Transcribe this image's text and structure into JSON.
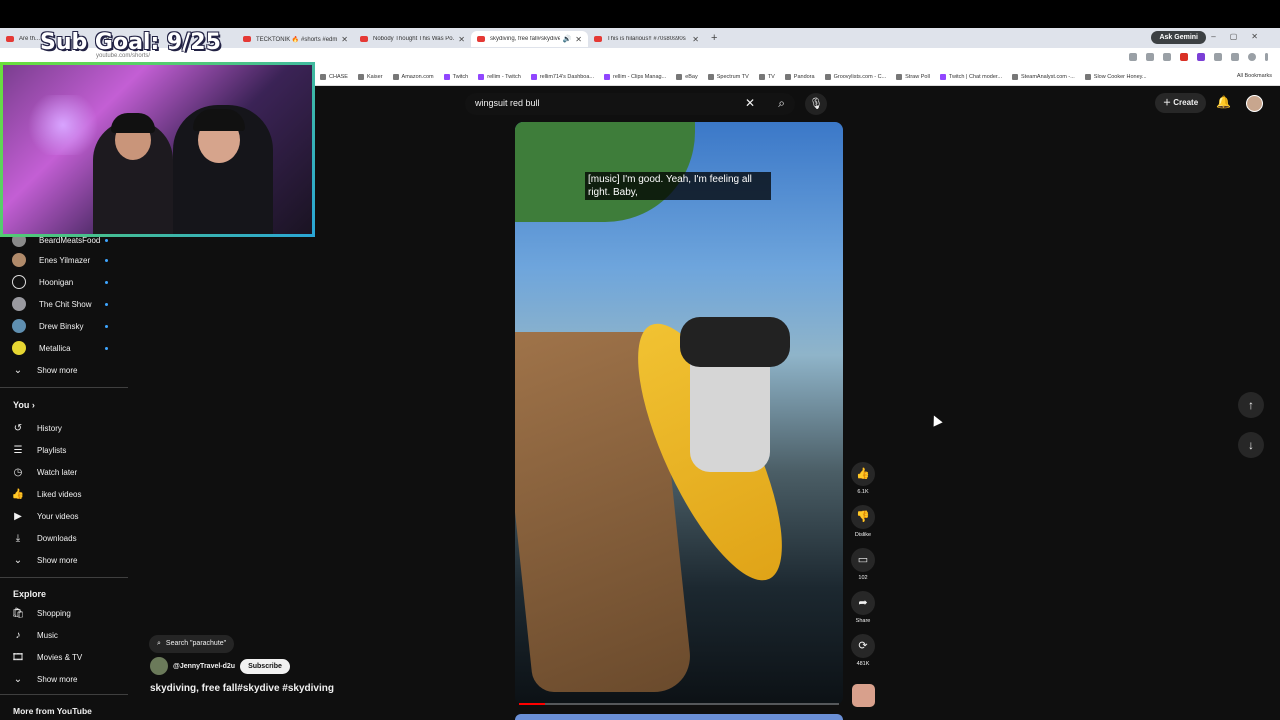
{
  "overlay": {
    "sub_goal": "Sub Goal: 9/25"
  },
  "browser": {
    "tabs": [
      {
        "title": "Are th..."
      },
      {
        "title": "TECKTONIK 🔥 #shorts #edm"
      },
      {
        "title": "Nobody Thought This Was Po..."
      },
      {
        "title": "skydiving, free fall#skydive",
        "active": true
      },
      {
        "title": "This is hilarious!! #70s80s90s"
      }
    ],
    "ask_gemini": "Ask Gemini",
    "url": "youtube.com/shorts/",
    "bookmarks": [
      "CHASE",
      "Kaiser",
      "Amazon.com",
      "Twitch",
      "rellim - Twitch",
      "rellim714's Dashboa...",
      "rellim - Clips Manag...",
      "eBay",
      "Spectrum TV",
      "TV",
      "Pandora",
      "Groovylists.com - C...",
      "Straw Poll",
      "Twitch | Chat moder...",
      "SteamAnalyst.com -...",
      "Slow Cooker Honey..."
    ],
    "all_bookmarks": "All Bookmarks"
  },
  "header": {
    "search_query": "wingsuit red bull",
    "create_label": "Create"
  },
  "sidebar": {
    "subscriptions": [
      {
        "label": "BeardMeatsFood",
        "color": "#8a8a8a"
      },
      {
        "label": "Enes Yilmazer",
        "color": "#b08a6a"
      },
      {
        "label": "Hoonigan",
        "color": "#111111"
      },
      {
        "label": "The Chit Show",
        "color": "#9a9aa0"
      },
      {
        "label": "Drew Binsky",
        "color": "#5f8fb0"
      },
      {
        "label": "Metallica",
        "color": "#e6d632"
      }
    ],
    "show_more": "Show more",
    "you_heading": "You",
    "you_items": [
      "History",
      "Playlists",
      "Watch later",
      "Liked videos",
      "Your videos",
      "Downloads"
    ],
    "explore_heading": "Explore",
    "explore_items": [
      "Shopping",
      "Music",
      "Movies & TV"
    ],
    "more_from": "More from YouTube"
  },
  "video": {
    "caption_line1": "[music] I'm good. Yeah, I'm feeling all",
    "caption_line2": "right. Baby,",
    "search_pill": "Search \"parachute\"",
    "channel": "@JennyTravel-d2u",
    "subscribe": "Subscribe",
    "title": "skydiving, free fall#skydive #skydiving",
    "progress_percent": 8
  },
  "actions": {
    "likes": "6.1K",
    "dislike": "Dislike",
    "comments": "102",
    "share": "Share",
    "remix": "481K"
  }
}
